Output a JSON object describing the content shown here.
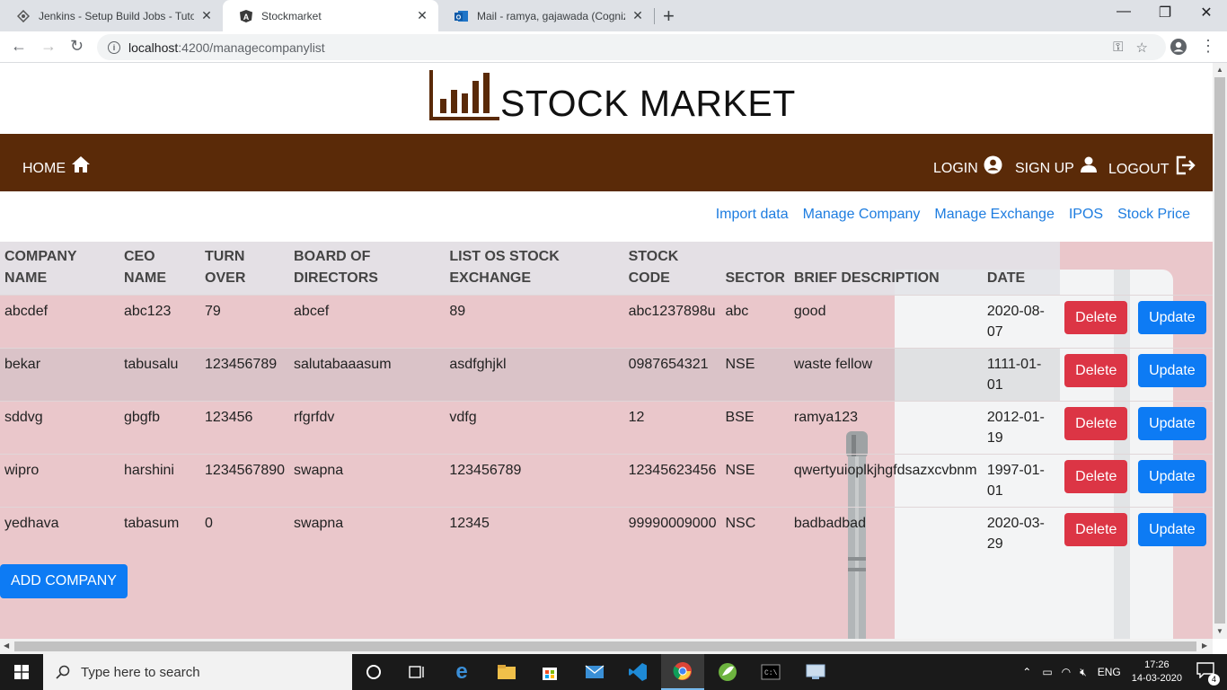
{
  "browser": {
    "tabs": [
      {
        "title": "Jenkins - Setup Build Jobs - Tutor",
        "active": false
      },
      {
        "title": "Stockmarket",
        "active": true
      },
      {
        "title": "Mail - ramya, gajawada (Cogniza",
        "active": false
      }
    ],
    "url_host": "localhost",
    "url_path": ":4200/managecompanylist"
  },
  "brand": {
    "title": "STOCK MARKET",
    "color": "#5a2a08"
  },
  "nav": {
    "home": "HOME",
    "login": "LOGIN",
    "signup": "SIGN UP",
    "logout": "LOGOUT"
  },
  "subnav": [
    "Import data",
    "Manage Company",
    "Manage Exchange",
    "IPOS",
    "Stock Price"
  ],
  "table": {
    "headers": [
      {
        "l1": "COMPANY",
        "l2": "NAME"
      },
      {
        "l1": "CEO",
        "l2": "NAME"
      },
      {
        "l1": "TURN",
        "l2": "OVER"
      },
      {
        "l1": "BOARD OF",
        "l2": "DIRECTORS"
      },
      {
        "l1": "LIST OS STOCK",
        "l2": "EXCHANGE"
      },
      {
        "l1": "STOCK",
        "l2": "CODE"
      },
      {
        "l1": "",
        "l2": "SECTOR"
      },
      {
        "l1": "",
        "l2": "BRIEF DESCRIPTION"
      },
      {
        "l1": "",
        "l2": "DATE"
      }
    ],
    "rows": [
      {
        "company": "abcdef",
        "ceo": "abc123",
        "turnover": "79",
        "board": "abcef",
        "exchange": "89",
        "code": "abc1237898u",
        "sector": "abc",
        "description": "good",
        "date1": "2020-08-",
        "date2": "07"
      },
      {
        "company": "bekar",
        "ceo": "tabusalu",
        "turnover": "123456789",
        "board": "salutabaaasum",
        "exchange": "asdfghjkl",
        "code": "0987654321",
        "sector": "NSE",
        "description": "waste fellow",
        "date1": "1111-01-",
        "date2": "01"
      },
      {
        "company": "sddvg",
        "ceo": "gbgfb",
        "turnover": "123456",
        "board": "rfgrfdv",
        "exchange": "vdfg",
        "code": "12",
        "sector": "BSE",
        "description": "ramya123",
        "date1": "2012-01-",
        "date2": "19"
      },
      {
        "company": "wipro",
        "ceo": "harshini",
        "turnover": "1234567890",
        "board": "swapna",
        "exchange": "123456789",
        "code": "12345623456",
        "sector": "NSE",
        "description": "qwertyuioplkjhgfdsazxcvbnm",
        "date1": "1997-01-",
        "date2": "01"
      },
      {
        "company": "yedhava",
        "ceo": "tabasum",
        "turnover": "0",
        "board": "swapna",
        "exchange": "12345",
        "code": "99990009000",
        "sector": "NSC",
        "description": "badbadbad",
        "date1": "2020-03-",
        "date2": "29"
      }
    ],
    "delete_label": "Delete",
    "update_label": "Update"
  },
  "add_company_label": "ADD COMPANY",
  "taskbar": {
    "search_placeholder": "Type here to search",
    "lang": "ENG",
    "time": "17:26",
    "date": "14-03-2020",
    "notifications": "4"
  }
}
